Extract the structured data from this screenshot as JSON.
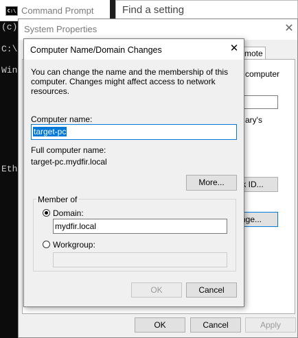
{
  "cmd": {
    "title": "Command Prompt",
    "icon_text": "C:\\",
    "lines": [
      "(c)",
      "C:\\",
      "Wind",
      "Ethe"
    ]
  },
  "settings": {
    "search_placeholder": "Find a setting"
  },
  "system_properties": {
    "title": "System Properties",
    "tab_remote": "emote",
    "partial_computer": "computer",
    "partial_library": "ary's",
    "network_id_button": "rk ID...",
    "change_button": "nge...",
    "ok": "OK",
    "cancel": "Cancel",
    "apply": "Apply"
  },
  "dialog": {
    "title": "Computer Name/Domain Changes",
    "description": "You can change the name and the membership of this computer. Changes might affect access to network resources.",
    "computer_name_label": "Computer name:",
    "computer_name_value": "target-pc",
    "full_name_label": "Full computer name:",
    "full_name_value": "target-pc.mydfir.local",
    "more_button": "More...",
    "member_of_legend": "Member of",
    "domain_label": "Domain:",
    "domain_value": "mydfir.local",
    "workgroup_label": "Workgroup:",
    "workgroup_value": "",
    "selected_membership": "domain",
    "ok": "OK",
    "cancel": "Cancel"
  }
}
